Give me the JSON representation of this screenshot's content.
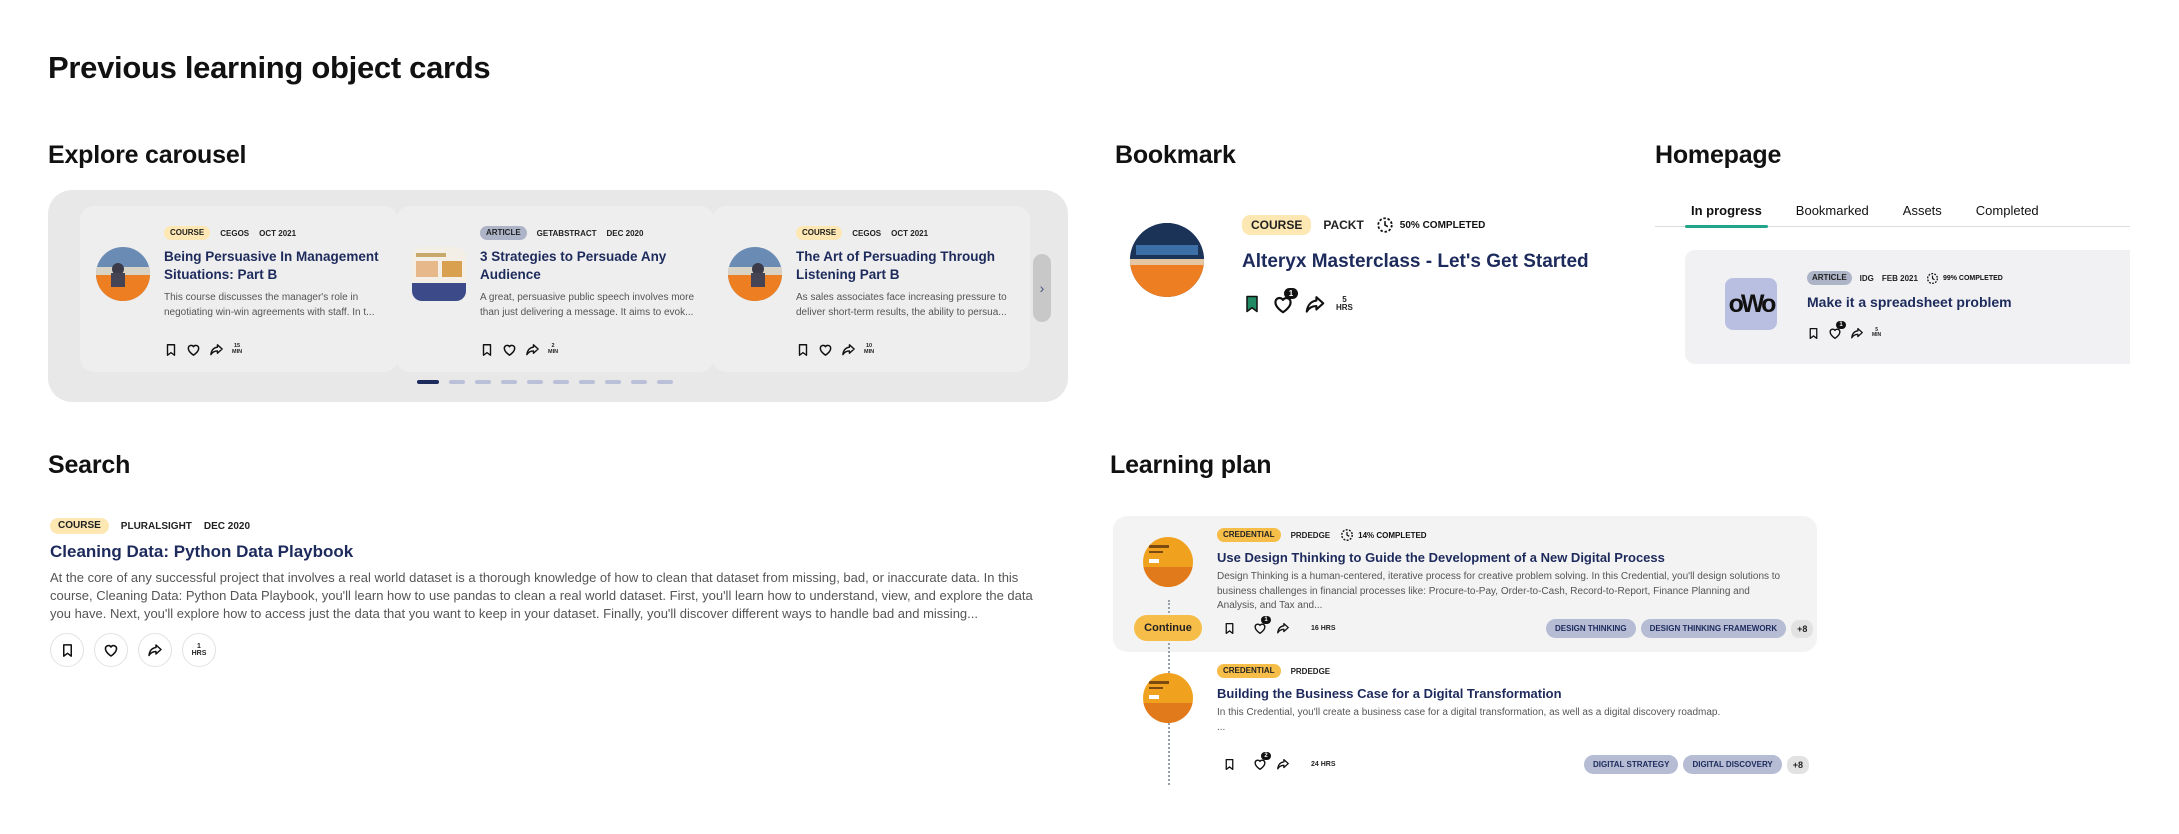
{
  "page": {
    "title": "Previous learning object cards"
  },
  "sections": {
    "explore": "Explore carousel",
    "bookmark": "Bookmark",
    "homepage": "Homepage",
    "search": "Search",
    "learning_plan": "Learning plan"
  },
  "carousel": {
    "cards": [
      {
        "type": "COURSE",
        "provider": "CEGOS",
        "date": "OCT 2021",
        "title": "Being Persuasive In Management Situations: Part B",
        "description": "This course discusses the manager's role in negotiating win-win agreements with staff. In t...",
        "duration_value": "15",
        "duration_unit": "MIN"
      },
      {
        "type": "ARTICLE",
        "provider": "GETABSTRACT",
        "date": "DEC 2020",
        "title": "3 Strategies to Persuade Any Audience",
        "description": "A great, persuasive public speech involves more than just delivering a message. It aims to evok...",
        "duration_value": "2",
        "duration_unit": "MIN"
      },
      {
        "type": "COURSE",
        "provider": "CEGOS",
        "date": "OCT 2021",
        "title": "The Art of Persuading Through Listening Part B",
        "description": "As sales associates face increasing pressure to deliver short-term results, the ability to persua...",
        "duration_value": "10",
        "duration_unit": "MIN"
      }
    ],
    "page_count": 10,
    "active_page": 1,
    "next_arrow": "›"
  },
  "bookmark": {
    "type": "COURSE",
    "provider": "PACKT",
    "progress": "50% COMPLETED",
    "title": "Alteryx Masterclass - Let's Get Started",
    "like_count": "1",
    "duration_value": "5",
    "duration_unit": "HRS"
  },
  "homepage": {
    "tabs": [
      "In progress",
      "Bookmarked",
      "Assets",
      "Completed"
    ],
    "active_tab": "In progress",
    "card": {
      "thumb_text": "oWo",
      "type": "ARTICLE",
      "provider": "IDG",
      "date": "FEB 2021",
      "progress": "99% COMPLETED",
      "title": "Make it a spreadsheet problem",
      "like_count": "1",
      "duration_value": "5",
      "duration_unit": "MIN"
    }
  },
  "search": {
    "type": "COURSE",
    "provider": "PLURALSIGHT",
    "date": "DEC 2020",
    "title": "Cleaning Data: Python Data Playbook",
    "description": "At the core of any successful project that involves a real world dataset is a thorough knowledge of how to clean that dataset from missing, bad, or inaccurate data. In this course, Cleaning Data: Python Data Playbook, you'll learn how to use pandas to clean a real world dataset. First, you'll learn how to understand, view, and explore the data you have. Next, you'll explore how to access just the data that you want to keep in your dataset. Finally, you'll discover different ways to handle bad and missing...",
    "duration_value": "1",
    "duration_unit": "HRS"
  },
  "learning_plan": {
    "items": [
      {
        "type": "CREDENTIAL",
        "provider": "PRDEDGE",
        "progress": "14% COMPLETED",
        "title": "Use Design Thinking to Guide the Development of a New Digital Process",
        "description": "Design Thinking is a human-centered, iterative process for creative problem solving. In this Credential, you'll design solutions to business challenges in financial processes like: Procure-to-Pay, Order-to-Cash, Record-to-Report, Finance Planning and Analysis, and Tax and...",
        "like_count": "1",
        "duration": "16 HRS",
        "tags": [
          "DESIGN THINKING",
          "DESIGN THINKING FRAMEWORK"
        ],
        "more": "+8",
        "cta": "Continue"
      },
      {
        "type": "CREDENTIAL",
        "provider": "PRDEDGE",
        "title": "Building the Business Case for a Digital Transformation",
        "description": "In this Credential, you'll create a business case for a digital transformation, as well as a digital discovery roadmap.",
        "ellipsis": "...",
        "like_count": "2",
        "duration": "24 HRS",
        "tags": [
          "DIGITAL STRATEGY",
          "DIGITAL DISCOVERY"
        ],
        "more": "+8"
      }
    ]
  },
  "colors": {
    "navy": "#1d2a5c",
    "course_badge": "#fde7b3",
    "article_badge": "#aeb4c8",
    "credential_badge": "#f6bd49",
    "tab_underline": "#22a58a",
    "bookmarked": "#1f8a63"
  },
  "icons": [
    "bookmark-icon",
    "heart-icon",
    "share-icon",
    "progress-icon",
    "chevron-right-icon"
  ]
}
